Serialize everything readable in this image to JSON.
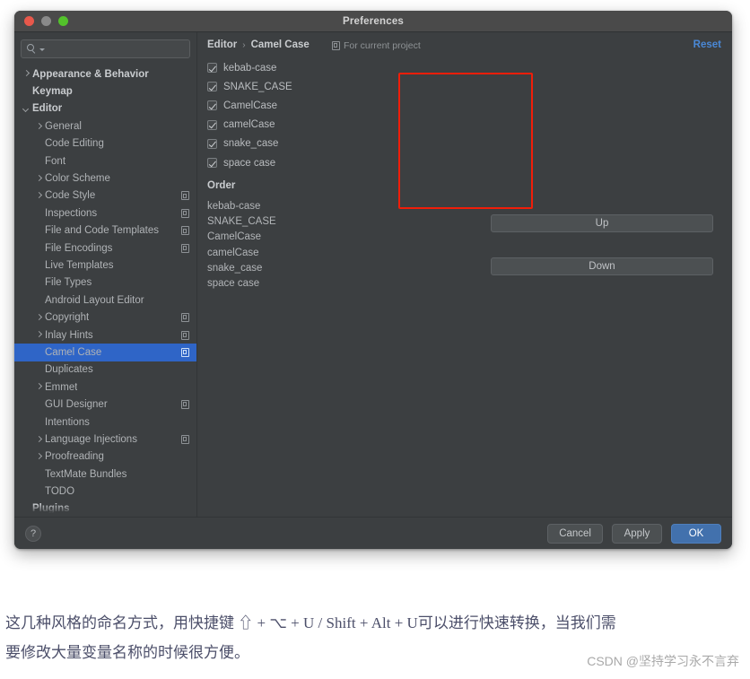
{
  "window": {
    "title": "Preferences",
    "traffic_lights": [
      "close",
      "minimize",
      "zoom"
    ]
  },
  "search": {
    "value": "",
    "placeholder": ""
  },
  "sidebar": {
    "items": [
      {
        "label": "Appearance & Behavior",
        "indent": 0,
        "arrow": "right",
        "bold": true,
        "scope_icon": false,
        "selected": false
      },
      {
        "label": "Keymap",
        "indent": 0,
        "arrow": "none",
        "bold": true,
        "scope_icon": false,
        "selected": false
      },
      {
        "label": "Editor",
        "indent": 0,
        "arrow": "down",
        "bold": true,
        "scope_icon": false,
        "selected": false
      },
      {
        "label": "General",
        "indent": 1,
        "arrow": "right",
        "bold": false,
        "scope_icon": false,
        "selected": false
      },
      {
        "label": "Code Editing",
        "indent": 1,
        "arrow": "none",
        "bold": false,
        "scope_icon": false,
        "selected": false
      },
      {
        "label": "Font",
        "indent": 1,
        "arrow": "none",
        "bold": false,
        "scope_icon": false,
        "selected": false
      },
      {
        "label": "Color Scheme",
        "indent": 1,
        "arrow": "right",
        "bold": false,
        "scope_icon": false,
        "selected": false
      },
      {
        "label": "Code Style",
        "indent": 1,
        "arrow": "right",
        "bold": false,
        "scope_icon": true,
        "selected": false
      },
      {
        "label": "Inspections",
        "indent": 1,
        "arrow": "none",
        "bold": false,
        "scope_icon": true,
        "selected": false
      },
      {
        "label": "File and Code Templates",
        "indent": 1,
        "arrow": "none",
        "bold": false,
        "scope_icon": true,
        "selected": false
      },
      {
        "label": "File Encodings",
        "indent": 1,
        "arrow": "none",
        "bold": false,
        "scope_icon": true,
        "selected": false
      },
      {
        "label": "Live Templates",
        "indent": 1,
        "arrow": "none",
        "bold": false,
        "scope_icon": false,
        "selected": false
      },
      {
        "label": "File Types",
        "indent": 1,
        "arrow": "none",
        "bold": false,
        "scope_icon": false,
        "selected": false
      },
      {
        "label": "Android Layout Editor",
        "indent": 1,
        "arrow": "none",
        "bold": false,
        "scope_icon": false,
        "selected": false
      },
      {
        "label": "Copyright",
        "indent": 1,
        "arrow": "right",
        "bold": false,
        "scope_icon": true,
        "selected": false
      },
      {
        "label": "Inlay Hints",
        "indent": 1,
        "arrow": "right",
        "bold": false,
        "scope_icon": true,
        "selected": false
      },
      {
        "label": "Camel Case",
        "indent": 1,
        "arrow": "none",
        "bold": false,
        "scope_icon": true,
        "selected": true
      },
      {
        "label": "Duplicates",
        "indent": 1,
        "arrow": "none",
        "bold": false,
        "scope_icon": false,
        "selected": false
      },
      {
        "label": "Emmet",
        "indent": 1,
        "arrow": "right",
        "bold": false,
        "scope_icon": false,
        "selected": false
      },
      {
        "label": "GUI Designer",
        "indent": 1,
        "arrow": "none",
        "bold": false,
        "scope_icon": true,
        "selected": false
      },
      {
        "label": "Intentions",
        "indent": 1,
        "arrow": "none",
        "bold": false,
        "scope_icon": false,
        "selected": false
      },
      {
        "label": "Language Injections",
        "indent": 1,
        "arrow": "right",
        "bold": false,
        "scope_icon": true,
        "selected": false
      },
      {
        "label": "Proofreading",
        "indent": 1,
        "arrow": "right",
        "bold": false,
        "scope_icon": false,
        "selected": false
      },
      {
        "label": "TextMate Bundles",
        "indent": 1,
        "arrow": "none",
        "bold": false,
        "scope_icon": false,
        "selected": false
      },
      {
        "label": "TODO",
        "indent": 1,
        "arrow": "none",
        "bold": false,
        "scope_icon": false,
        "selected": false
      },
      {
        "label": "Plugins",
        "indent": 0,
        "arrow": "none",
        "bold": true,
        "scope_icon": false,
        "selected": false
      }
    ]
  },
  "detail": {
    "breadcrumb": {
      "parent": "Editor",
      "separator": "›",
      "current": "Camel Case"
    },
    "scope_note": "For current project",
    "reset_label": "Reset",
    "checkboxes": [
      {
        "label": "kebab-case",
        "checked": true
      },
      {
        "label": "SNAKE_CASE",
        "checked": true
      },
      {
        "label": "CamelCase",
        "checked": true
      },
      {
        "label": "camelCase",
        "checked": true
      },
      {
        "label": "snake_case",
        "checked": true
      },
      {
        "label": "space case",
        "checked": true
      }
    ],
    "order_title": "Order",
    "order": [
      "kebab-case",
      "SNAKE_CASE",
      "CamelCase",
      "camelCase",
      "snake_case",
      "space case"
    ],
    "up_label": "Up",
    "down_label": "Down",
    "highlight_color": "#f01d09",
    "accent_color": "#4a88d6",
    "selection_color": "#2f65c7"
  },
  "footer": {
    "help_label": "?",
    "cancel_label": "Cancel",
    "apply_label": "Apply",
    "ok_label": "OK"
  },
  "caption": {
    "line1": "这几种风格的命名方式，用快捷键 ⇧ + ⌥ + U / Shift + Alt + U可以进行快速转换，当我们需",
    "line2": "要修改大量变量名称的时候很方便。"
  },
  "watermark": "CSDN @坚持学习永不言弃"
}
